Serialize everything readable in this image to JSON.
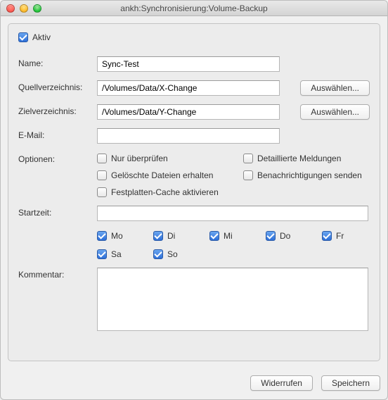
{
  "window": {
    "title": "ankh:Synchronisierung:Volume-Backup"
  },
  "active": {
    "label": "Aktiv",
    "checked": true
  },
  "fields": {
    "name_label": "Name:",
    "name_value": "Sync-Test",
    "source_label": "Quellverzeichnis:",
    "source_value": "/Volumes/Data/X-Change",
    "target_label": "Zielverzeichnis:",
    "target_value": "/Volumes/Data/Y-Change",
    "email_label": "E-Mail:",
    "email_value": "",
    "options_label": "Optionen:",
    "starttime_label": "Startzeit:",
    "starttime_value": "",
    "comment_label": "Kommentar:",
    "comment_value": "",
    "choose_button": "Auswählen..."
  },
  "options": {
    "check_only": {
      "label": "Nur überprüfen",
      "checked": false
    },
    "detailed": {
      "label": "Detaillierte Meldungen",
      "checked": false
    },
    "keep_deleted": {
      "label": "Gelöschte Dateien erhalten",
      "checked": false
    },
    "notify": {
      "label": "Benachrichtigungen senden",
      "checked": false
    },
    "disk_cache": {
      "label": "Festplatten-Cache aktivieren",
      "checked": false
    }
  },
  "days": {
    "mo": {
      "label": "Mo",
      "checked": true
    },
    "di": {
      "label": "Di",
      "checked": true
    },
    "mi": {
      "label": "Mi",
      "checked": true
    },
    "do": {
      "label": "Do",
      "checked": true
    },
    "fr": {
      "label": "Fr",
      "checked": true
    },
    "sa": {
      "label": "Sa",
      "checked": true
    },
    "so": {
      "label": "So",
      "checked": true
    }
  },
  "footer": {
    "revert": "Widerrufen",
    "save": "Speichern"
  }
}
